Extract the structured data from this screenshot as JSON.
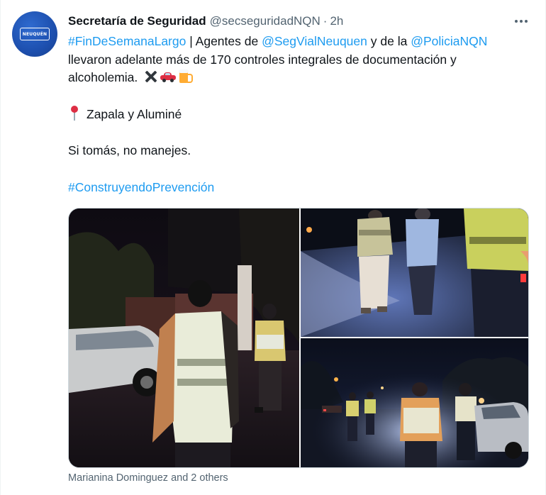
{
  "author": {
    "name": "Secretaría de Seguridad",
    "handle": "@secseguridadNQN",
    "separator": "·",
    "time": "2h",
    "avatar_label": "NEUQUÉN",
    "avatar_icon": "neuquen-logo"
  },
  "more_icon": "ellipsis-icon",
  "tweet": {
    "hashtag1": "#FinDeSemanaLargo",
    "text1": " | Agentes de ",
    "mention1": "@SegVialNeuquen",
    "text2": " y de la ",
    "mention2": "@PoliciaNQN",
    "text3": "llevaron adelante más de 170 controles integrales de documentación y alcoholemia.",
    "location": "Zapala y Aluminé",
    "slogan": "Si tomás, no manejes.",
    "hashtag2": "#ConstruyendoPrevención"
  },
  "emojis": [
    "cross-mark-emoji",
    "car-emoji",
    "beer-emoji",
    "round-pushpin-emoji"
  ],
  "media": {
    "photos": [
      "checkpoint-night-photo-1",
      "checkpoint-night-photo-2",
      "checkpoint-night-photo-3"
    ]
  },
  "footer": {
    "tagged": "Marianina Dominguez and 2 others"
  },
  "colors": {
    "link": "#1d9bf0",
    "secondary_text": "#536471",
    "primary_text": "#0f1419",
    "avatar_bg": "#1d4fae"
  }
}
